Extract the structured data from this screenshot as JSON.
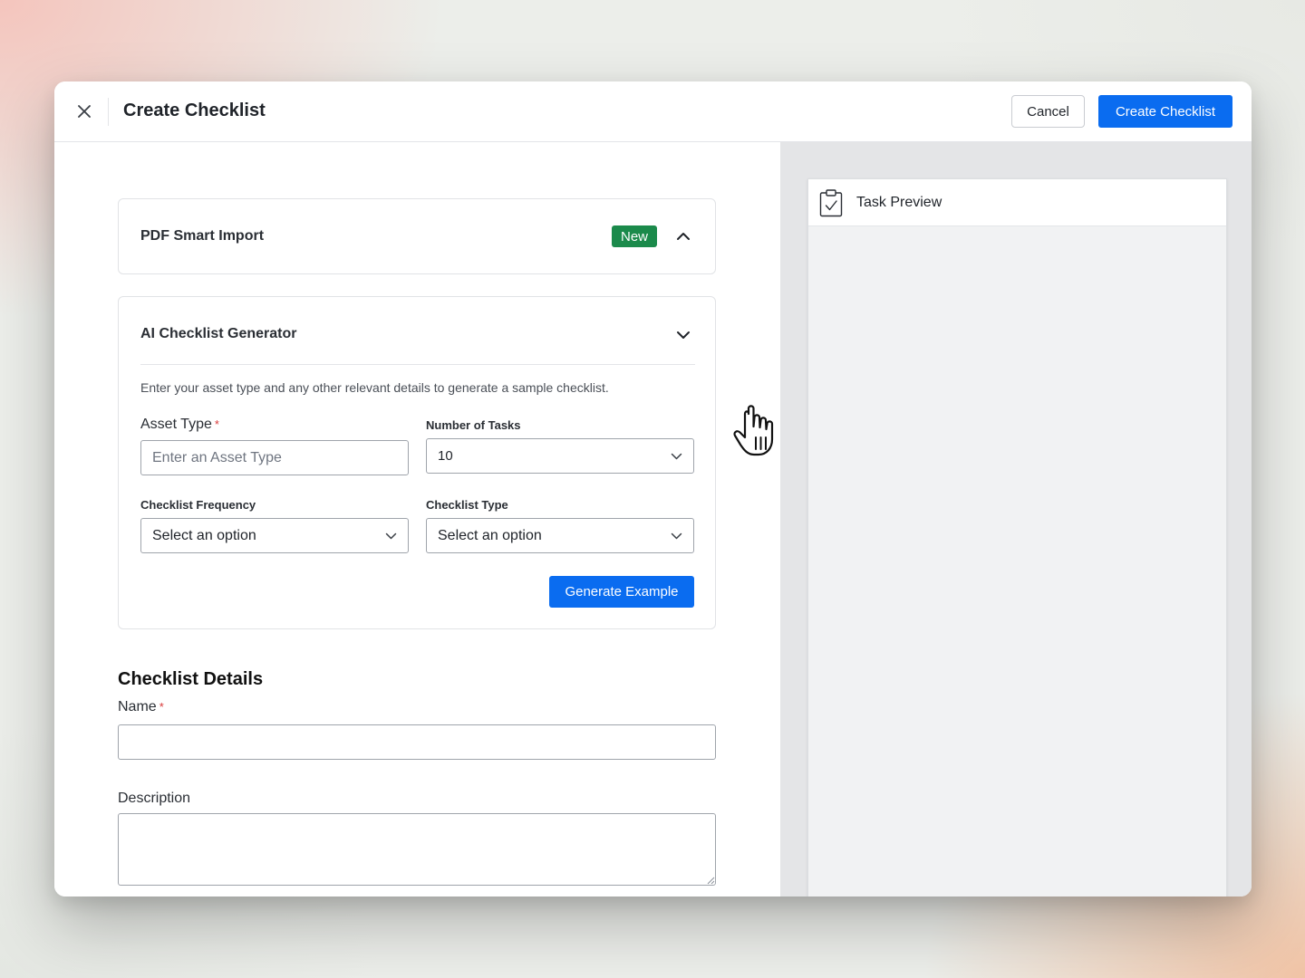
{
  "header": {
    "title": "Create Checklist",
    "cancel_label": "Cancel",
    "create_label": "Create Checklist",
    "close_icon": "close-icon"
  },
  "pdf_import": {
    "title": "PDF Smart Import",
    "badge": "New",
    "badge_color": "#1b8a4b",
    "expanded_icon": "chevron-up-icon"
  },
  "ai_generator": {
    "title": "AI Checklist Generator",
    "toggle_icon": "chevron-down-icon",
    "description": "Enter your asset type and any other relevant details to generate a sample checklist.",
    "asset_type": {
      "label": "Asset Type",
      "required_mark": "*",
      "placeholder": "Enter an Asset Type",
      "value": ""
    },
    "number_of_tasks": {
      "label": "Number of Tasks",
      "value": "10"
    },
    "frequency": {
      "label": "Checklist Frequency",
      "value": "Select an option"
    },
    "type": {
      "label": "Checklist Type",
      "value": "Select an option"
    },
    "generate_label": "Generate Example"
  },
  "details": {
    "title": "Checklist Details",
    "name_label": "Name",
    "name_required_mark": "*",
    "name_value": "",
    "description_label": "Description",
    "description_value": ""
  },
  "preview": {
    "title": "Task Preview",
    "icon": "clipboard-check-icon"
  },
  "colors": {
    "primary": "#0a6cf0",
    "required": "#d93a3a",
    "badge_green": "#1b8a4b"
  }
}
